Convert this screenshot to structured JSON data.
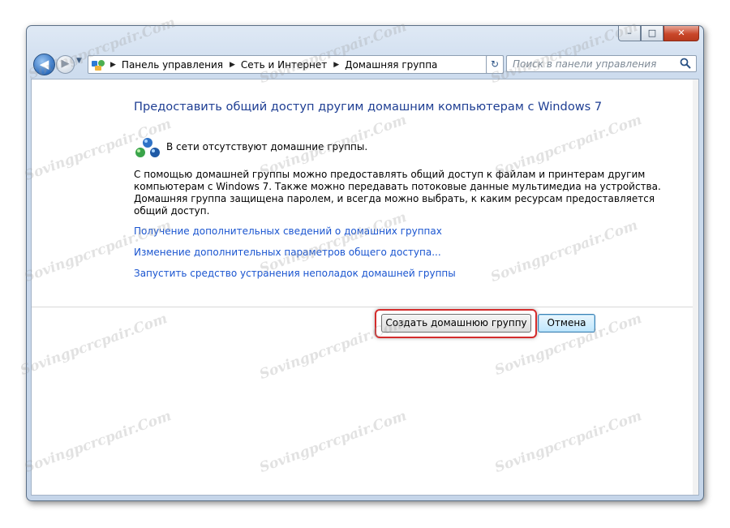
{
  "window": {
    "caption_buttons": {
      "minimize": "–",
      "maximize": "□",
      "close": "✕"
    }
  },
  "navigation": {
    "back_icon": "back-arrow-icon",
    "forward_icon": "forward-arrow-icon",
    "breadcrumbs": [
      "Панель управления",
      "Сеть и Интернет",
      "Домашняя группа"
    ],
    "search_placeholder": "Поиск в панели управления"
  },
  "main": {
    "title": "Предоставить общий доступ другим домашним компьютерам с Windows 7",
    "status": "В сети отсутствуют домашние группы.",
    "description_lines": [
      "С помощью домашней группы можно предоставлять общий доступ к файлам и принтерам другим",
      "компьютерам с Windows 7. Также можно передавать потоковые данные мультимедиа на устройства.",
      "Домашняя группа защищена паролем, и всегда можно выбрать, к каким ресурсам предоставляется",
      "общий доступ."
    ],
    "links": [
      "Получение дополнительных сведений о домашних группах",
      "Изменение дополнительных параметров общего доступа...",
      "Запустить средство устранения неполадок домашней группы"
    ],
    "buttons": {
      "create": "Создать домашнюю группу",
      "cancel": "Отмена"
    }
  },
  "watermark": "Sovingpcrcpair.Com",
  "colors": {
    "title": "#1e3e93",
    "link": "#1a55d0",
    "highlight": "#d42c2c"
  }
}
